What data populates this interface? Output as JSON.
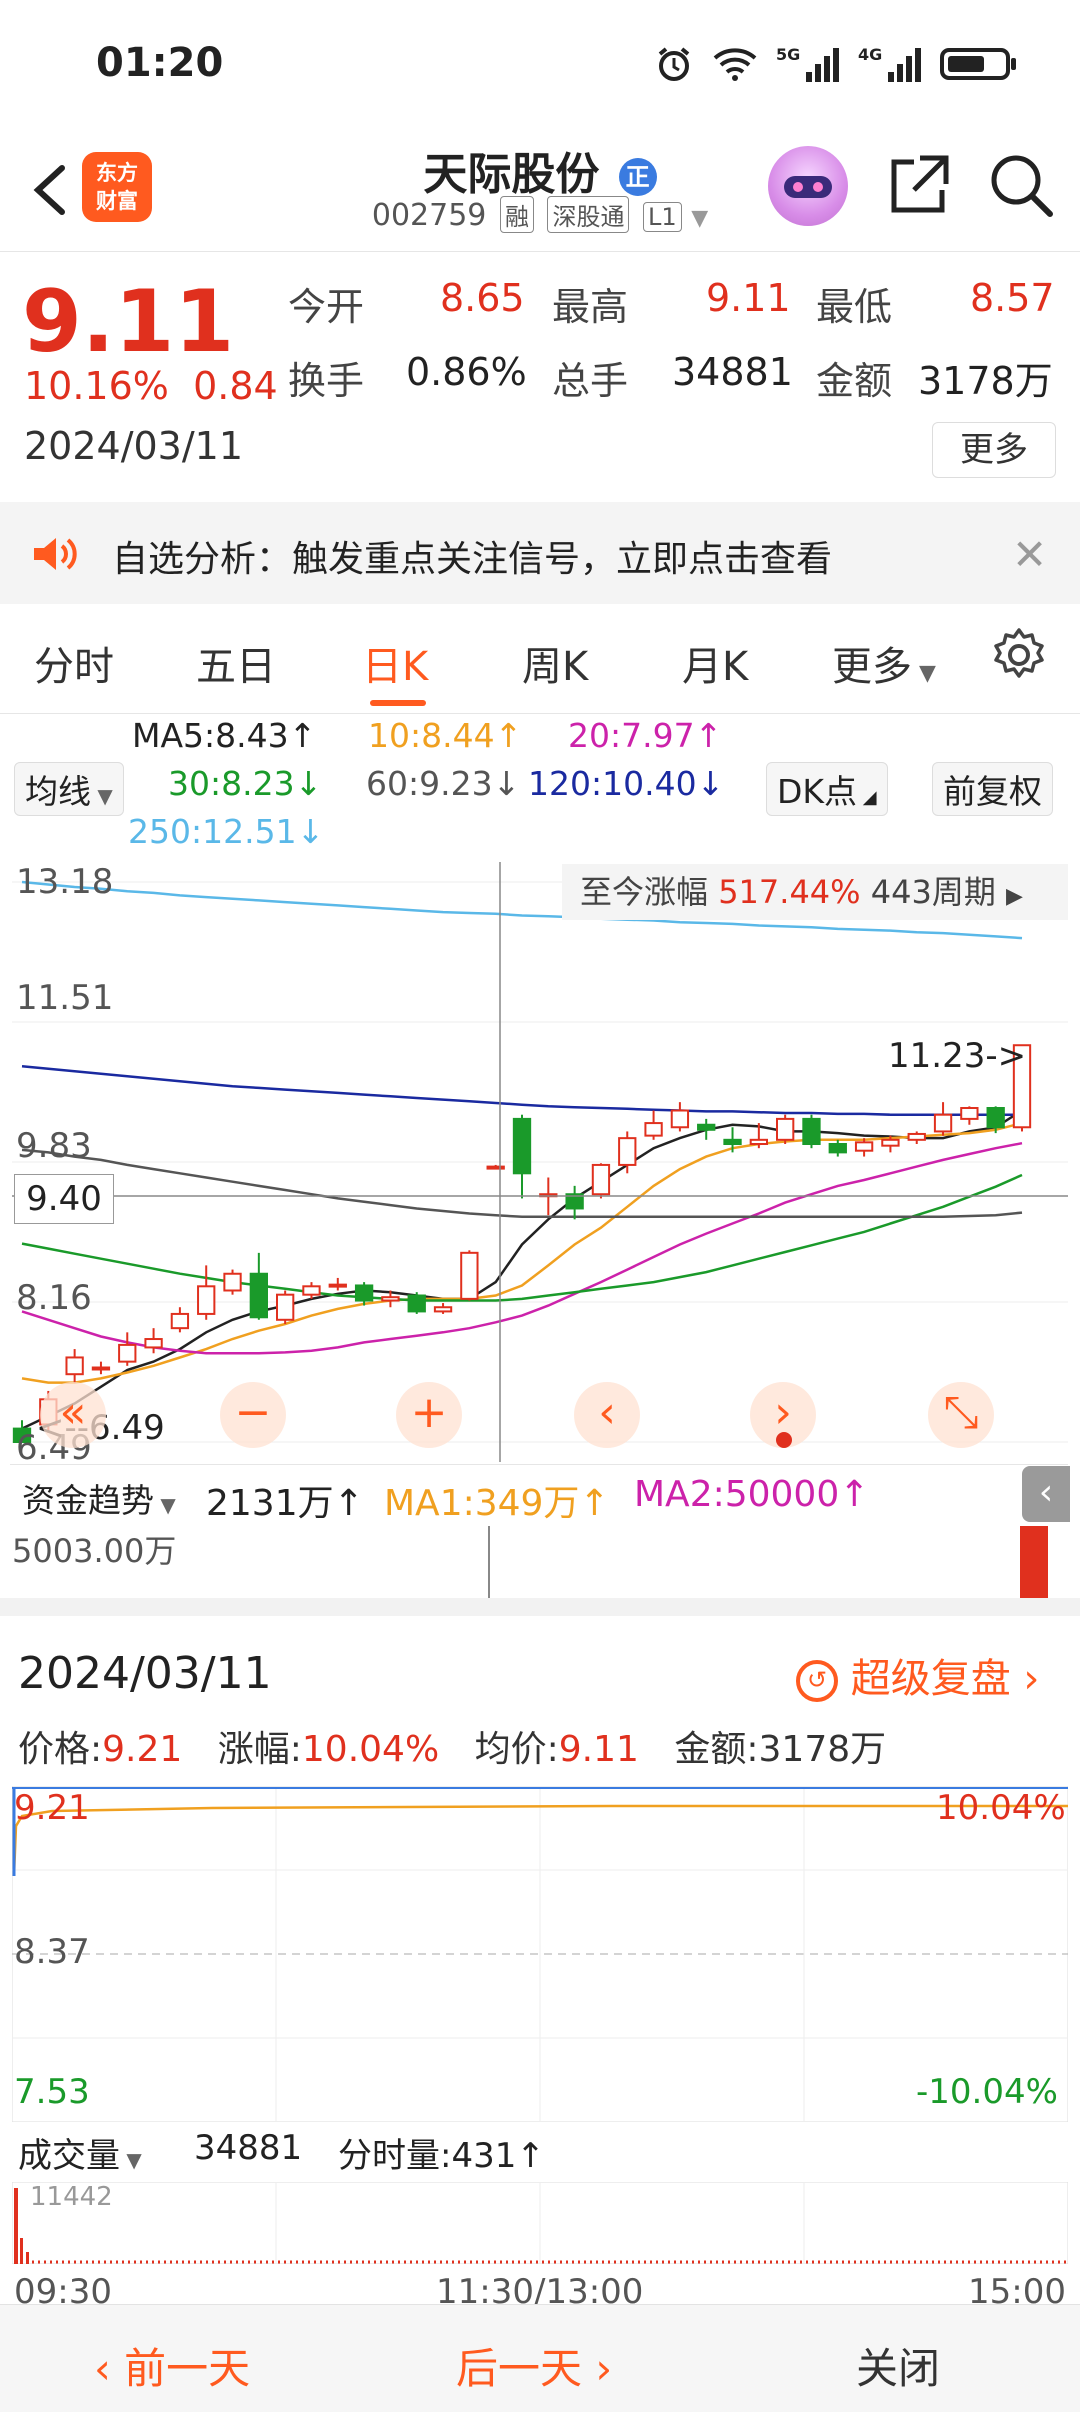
{
  "status_bar": {
    "time": "01:20"
  },
  "header": {
    "app_logo_line1": "东方",
    "app_logo_line2": "财富",
    "stock_name": "天际股份",
    "stock_name_badge": "正",
    "stock_code": "002759",
    "tags": [
      "融",
      "深股通",
      "L1"
    ]
  },
  "quote": {
    "price": "9.11",
    "change_pct": "10.16%",
    "change_abs": "0.84",
    "date": "2024/03/11",
    "fields": [
      {
        "label": "今开",
        "value": "8.65"
      },
      {
        "label": "最高",
        "value": "9.11"
      },
      {
        "label": "最低",
        "value": "8.57"
      },
      {
        "label": "换手",
        "value": "0.86%"
      },
      {
        "label": "总手",
        "value": "34881"
      },
      {
        "label": "金额",
        "value": "3178万"
      }
    ],
    "more_label": "更多"
  },
  "notice": {
    "text": "自选分析：触发重点关注信号，立即点击查看"
  },
  "tabs": [
    "分时",
    "五日",
    "日K",
    "周K",
    "月K",
    "更多"
  ],
  "active_tab": "日K",
  "ma_legend": {
    "selector": "均线",
    "ma5": "MA5:8.43↑",
    "ma10": "10:8.44↑",
    "ma20": "20:7.97↑",
    "ma30": "30:8.23↓",
    "ma60": "60:9.23↓",
    "ma120": "120:10.40↓",
    "ma250": "250:12.51↓",
    "dk_label": "DK点",
    "adjust_label": "前复权",
    "colors": {
      "ma5": "#222222",
      "ma10": "#f0a020",
      "ma20": "#cc22aa",
      "ma30": "#1a9a2a",
      "ma60": "#555555",
      "ma120": "#1a2aa0",
      "ma250": "#5ab8e8"
    }
  },
  "kline": {
    "range_label": "至今涨幅",
    "range_value": "517.44%",
    "range_period": "443周期",
    "price_ticks": [
      "13.18",
      "11.51",
      "9.83",
      "8.16",
      "6.49"
    ],
    "crosshair_price": "9.40",
    "max_annotation": "11.23->",
    "min_annotation": "<--6.49"
  },
  "chart_data": {
    "type": "candlestick",
    "ylim": [
      6.49,
      13.18
    ],
    "candles": [
      {
        "o": 6.65,
        "c": 6.49,
        "h": 6.75,
        "l": 6.49
      },
      {
        "o": 6.7,
        "c": 7.0,
        "h": 7.1,
        "l": 6.6
      },
      {
        "o": 7.3,
        "c": 7.5,
        "h": 7.6,
        "l": 7.2
      },
      {
        "o": 7.38,
        "c": 7.38,
        "h": 7.45,
        "l": 7.3
      },
      {
        "o": 7.45,
        "c": 7.65,
        "h": 7.8,
        "l": 7.4
      },
      {
        "o": 7.62,
        "c": 7.72,
        "h": 7.85,
        "l": 7.55
      },
      {
        "o": 7.85,
        "c": 8.02,
        "h": 8.1,
        "l": 7.8
      },
      {
        "o": 8.02,
        "c": 8.35,
        "h": 8.6,
        "l": 7.95
      },
      {
        "o": 8.3,
        "c": 8.5,
        "h": 8.55,
        "l": 8.25
      },
      {
        "o": 8.5,
        "c": 7.98,
        "h": 8.75,
        "l": 7.95
      },
      {
        "o": 7.95,
        "c": 8.25,
        "h": 8.3,
        "l": 7.9
      },
      {
        "o": 8.25,
        "c": 8.35,
        "h": 8.4,
        "l": 8.2
      },
      {
        "o": 8.37,
        "c": 8.37,
        "h": 8.45,
        "l": 8.3
      },
      {
        "o": 8.36,
        "c": 8.18,
        "h": 8.4,
        "l": 8.12
      },
      {
        "o": 8.18,
        "c": 8.22,
        "h": 8.3,
        "l": 8.1
      },
      {
        "o": 8.24,
        "c": 8.05,
        "h": 8.28,
        "l": 8.02
      },
      {
        "o": 8.05,
        "c": 8.1,
        "h": 8.15,
        "l": 8.02
      },
      {
        "o": 8.2,
        "c": 8.75,
        "h": 8.78,
        "l": 8.18
      },
      {
        "o": 9.78,
        "c": 9.78,
        "h": 9.8,
        "l": 9.75
      },
      {
        "o": 10.35,
        "c": 9.7,
        "h": 10.4,
        "l": 9.4
      },
      {
        "o": 9.45,
        "c": 9.45,
        "h": 9.65,
        "l": 9.2
      },
      {
        "o": 9.45,
        "c": 9.28,
        "h": 9.55,
        "l": 9.15
      },
      {
        "o": 9.45,
        "c": 9.8,
        "h": 9.82,
        "l": 9.4
      },
      {
        "o": 9.8,
        "c": 10.12,
        "h": 10.2,
        "l": 9.7
      },
      {
        "o": 10.15,
        "c": 10.3,
        "h": 10.45,
        "l": 10.1
      },
      {
        "o": 10.25,
        "c": 10.45,
        "h": 10.55,
        "l": 10.2
      },
      {
        "o": 10.28,
        "c": 10.22,
        "h": 10.35,
        "l": 10.1
      },
      {
        "o": 10.1,
        "c": 10.05,
        "h": 10.25,
        "l": 9.95
      },
      {
        "o": 10.05,
        "c": 10.1,
        "h": 10.3,
        "l": 10.0
      },
      {
        "o": 10.1,
        "c": 10.35,
        "h": 10.4,
        "l": 10.05
      },
      {
        "o": 10.35,
        "c": 10.05,
        "h": 10.4,
        "l": 10.0
      },
      {
        "o": 10.05,
        "c": 9.95,
        "h": 10.1,
        "l": 9.9
      },
      {
        "o": 9.97,
        "c": 10.07,
        "h": 10.12,
        "l": 9.9
      },
      {
        "o": 10.03,
        "c": 10.1,
        "h": 10.15,
        "l": 9.95
      },
      {
        "o": 10.1,
        "c": 10.17,
        "h": 10.2,
        "l": 10.05
      },
      {
        "o": 10.2,
        "c": 10.4,
        "h": 10.55,
        "l": 10.15
      },
      {
        "o": 10.35,
        "c": 10.48,
        "h": 10.5,
        "l": 10.28
      },
      {
        "o": 10.48,
        "c": 10.25,
        "h": 10.5,
        "l": 10.18
      },
      {
        "o": 10.25,
        "c": 11.23,
        "h": 11.23,
        "l": 10.2
      }
    ],
    "ma_lines": {
      "ma5": [
        6.65,
        6.8,
        6.95,
        7.15,
        7.35,
        7.45,
        7.6,
        7.8,
        7.95,
        8.05,
        8.12,
        8.2,
        8.26,
        8.3,
        8.28,
        8.24,
        8.2,
        8.2,
        8.4,
        8.85,
        9.15,
        9.4,
        9.6,
        9.8,
        10.0,
        10.12,
        10.22,
        10.28,
        10.26,
        10.2,
        10.2,
        10.18,
        10.15,
        10.14,
        10.12,
        10.12,
        10.2,
        10.25,
        10.45
      ],
      "ma10": [
        7.25,
        7.2,
        7.2,
        7.25,
        7.32,
        7.4,
        7.5,
        7.6,
        7.72,
        7.82,
        7.9,
        8.0,
        8.08,
        8.14,
        8.18,
        8.2,
        8.2,
        8.2,
        8.24,
        8.36,
        8.6,
        8.85,
        9.05,
        9.3,
        9.55,
        9.75,
        9.9,
        10.0,
        10.05,
        10.08,
        10.1,
        10.1,
        10.1,
        10.12,
        10.14,
        10.16,
        10.18,
        10.22,
        10.3
      ],
      "ma20": [
        8.05,
        7.95,
        7.85,
        7.75,
        7.68,
        7.62,
        7.58,
        7.55,
        7.55,
        7.55,
        7.56,
        7.58,
        7.62,
        7.68,
        7.72,
        7.76,
        7.8,
        7.85,
        7.92,
        8.0,
        8.12,
        8.26,
        8.4,
        8.55,
        8.7,
        8.85,
        8.98,
        9.1,
        9.22,
        9.35,
        9.45,
        9.55,
        9.62,
        9.7,
        9.78,
        9.86,
        9.93,
        10.0,
        10.06
      ],
      "ma30": [
        8.86,
        8.8,
        8.74,
        8.68,
        8.62,
        8.56,
        8.5,
        8.45,
        8.4,
        8.36,
        8.32,
        8.28,
        8.24,
        8.22,
        8.2,
        8.18,
        8.18,
        8.18,
        8.18,
        8.2,
        8.24,
        8.28,
        8.32,
        8.36,
        8.4,
        8.46,
        8.52,
        8.6,
        8.68,
        8.76,
        8.84,
        8.92,
        9.0,
        9.1,
        9.2,
        9.3,
        9.42,
        9.54,
        9.68
      ],
      "ma60": [
        9.98,
        9.95,
        9.9,
        9.86,
        9.8,
        9.75,
        9.7,
        9.65,
        9.6,
        9.55,
        9.5,
        9.45,
        9.4,
        9.36,
        9.32,
        9.28,
        9.25,
        9.22,
        9.2,
        9.18,
        9.18,
        9.18,
        9.18,
        9.18,
        9.18,
        9.18,
        9.18,
        9.18,
        9.18,
        9.18,
        9.18,
        9.18,
        9.18,
        9.18,
        9.18,
        9.18,
        9.19,
        9.2,
        9.23
      ],
      "ma120": [
        10.98,
        10.95,
        10.92,
        10.89,
        10.86,
        10.83,
        10.8,
        10.77,
        10.74,
        10.72,
        10.7,
        10.68,
        10.66,
        10.64,
        10.62,
        10.6,
        10.58,
        10.56,
        10.54,
        10.52,
        10.5,
        10.49,
        10.48,
        10.47,
        10.46,
        10.45,
        10.44,
        10.44,
        10.43,
        10.42,
        10.42,
        10.41,
        10.41,
        10.4,
        10.4,
        10.4,
        10.4,
        10.4,
        10.4
      ],
      "ma250": [
        13.18,
        13.15,
        13.12,
        13.1,
        13.07,
        13.05,
        13.02,
        13.0,
        12.98,
        12.96,
        12.94,
        12.92,
        12.9,
        12.88,
        12.86,
        12.84,
        12.82,
        12.81,
        12.8,
        12.78,
        12.77,
        12.76,
        12.74,
        12.73,
        12.72,
        12.7,
        12.69,
        12.68,
        12.66,
        12.65,
        12.64,
        12.62,
        12.61,
        12.6,
        12.58,
        12.57,
        12.55,
        12.53,
        12.51
      ]
    }
  },
  "chart_controls": [
    "«",
    "−",
    "+",
    "‹",
    "›",
    "⤡"
  ],
  "capital_flow": {
    "selector": "资金趋势",
    "value": "2131万↑",
    "ma1": "MA1:349万↑",
    "ma2": "MA2:50000↑",
    "axis_label": "5003.00万"
  },
  "day_detail": {
    "date": "2024/03/11",
    "replay_label": "超级复盘",
    "stats": [
      {
        "label": "价格:",
        "value": "9.21"
      },
      {
        "label": "涨幅:",
        "value": "10.04%"
      },
      {
        "label": "均价:",
        "value": "9.11"
      },
      {
        "label": "金额:",
        "value": "3178万"
      }
    ],
    "intraday": {
      "top_price": "9.21",
      "mid_price": "8.37",
      "bottom_price": "7.53",
      "top_pct": "10.04%",
      "bottom_pct": "-10.04%"
    },
    "volume": {
      "selector": "成交量",
      "total": "34881",
      "current_label": "分时量:431↑",
      "max_label": "11442"
    },
    "time_axis": [
      "09:30",
      "11:30/13:00",
      "15:00"
    ]
  },
  "bottom_bar": {
    "prev_day": "前一天",
    "next_day": "后一天",
    "close": "关闭"
  }
}
